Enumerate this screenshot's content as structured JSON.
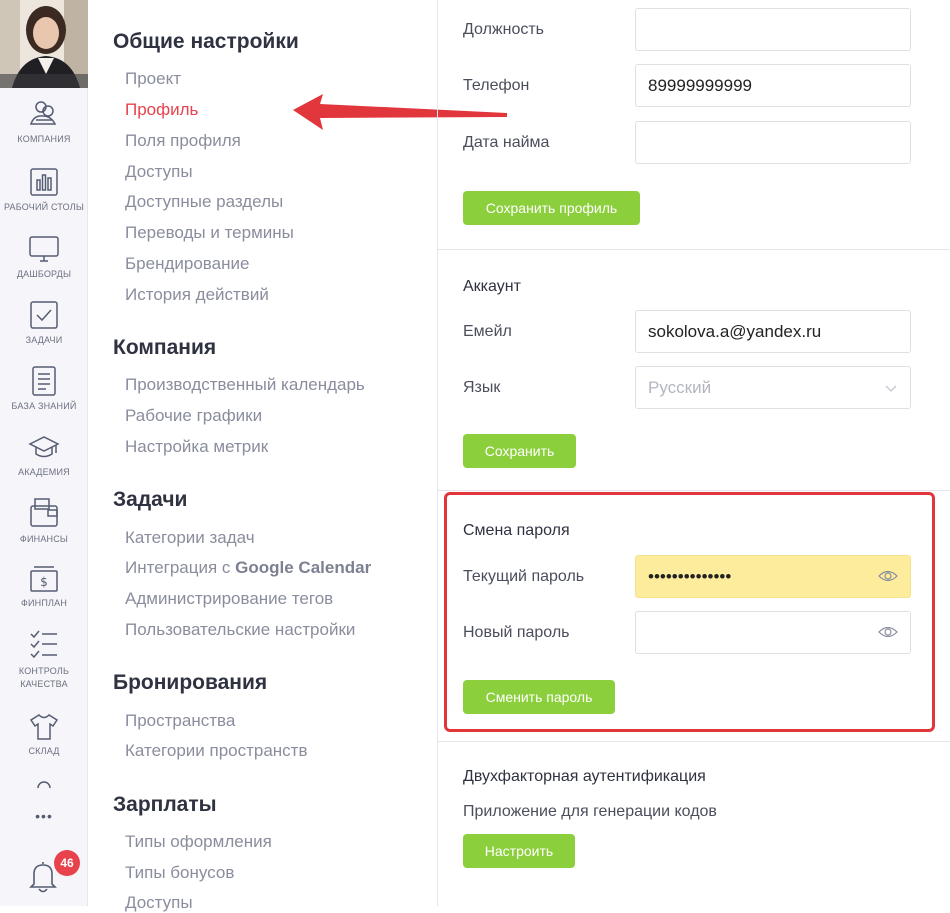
{
  "rail": {
    "items": [
      {
        "label": "КОМПАНИЯ",
        "icon": "company-icon"
      },
      {
        "label": "РАБОЧИЙ СТОЛЫ",
        "icon": "desktop-charts-icon"
      },
      {
        "label": "ДАШБОРДЫ",
        "icon": "monitor-icon"
      },
      {
        "label": "ЗАДАЧИ",
        "icon": "checkbox-icon"
      },
      {
        "label": "БАЗА ЗНАНИЙ",
        "icon": "document-icon"
      },
      {
        "label": "АКАДЕМИЯ",
        "icon": "graduation-cap-icon"
      },
      {
        "label": "ФИНАНСЫ",
        "icon": "wallet-icon"
      },
      {
        "label": "ФИНПЛАН",
        "icon": "cash-icon"
      },
      {
        "label": "КОНТРОЛЬ",
        "label2": "КАЧЕСТВА",
        "icon": "checklist-icon"
      },
      {
        "label": "СКЛАД",
        "icon": "tshirt-icon"
      }
    ],
    "more": "•••",
    "notifications_count": "46"
  },
  "menu": {
    "sections": [
      {
        "title": "Общие настройки",
        "items": [
          "Проект",
          "Профиль",
          "Поля профиля",
          "Доступы",
          "Доступные разделы",
          "Переводы и термины",
          "Брендирование",
          "История действий"
        ]
      },
      {
        "title": "Компания",
        "items": [
          "Производственный календарь",
          "Рабочие графики",
          "Настройка метрик"
        ]
      },
      {
        "title": "Задачи",
        "items": [
          "Категории задач",
          "Интеграция с ",
          "Администрирование тегов",
          "Пользовательские настройки"
        ]
      },
      {
        "title": "Бронирования",
        "items": [
          "Пространства",
          "Категории пространств"
        ]
      },
      {
        "title": "Зарплаты",
        "items": [
          "Типы оформления",
          "Типы бонусов",
          "Доступы"
        ]
      }
    ],
    "google_calendar": "Google Calendar",
    "active_color": "#e8424d"
  },
  "profile": {
    "position_label": "Должность",
    "position_value": "",
    "phone_label": "Телефон",
    "phone_value": "89999999999",
    "hire_label": "Дата найма",
    "hire_value": "",
    "save_label": "Сохранить профиль"
  },
  "account": {
    "title": "Аккаунт",
    "email_label": "Емейл",
    "email_value": "sokolova.a@yandex.ru",
    "lang_label": "Язык",
    "lang_value": "Русский",
    "save_label": "Сохранить"
  },
  "password": {
    "title": "Смена пароля",
    "current_label": "Текущий пароль",
    "current_value": "••••••••••••••",
    "new_label": "Новый пароль",
    "new_value": "",
    "submit_label": "Сменить пароль"
  },
  "twofa": {
    "title": "Двухфакторная аутентификация",
    "subtitle": "Приложение для генерации кодов",
    "setup_label": "Настроить"
  },
  "colors": {
    "accent_green": "#8ccf3c",
    "highlight_red": "#e2363d",
    "yellow_field": "#fcec9c"
  }
}
